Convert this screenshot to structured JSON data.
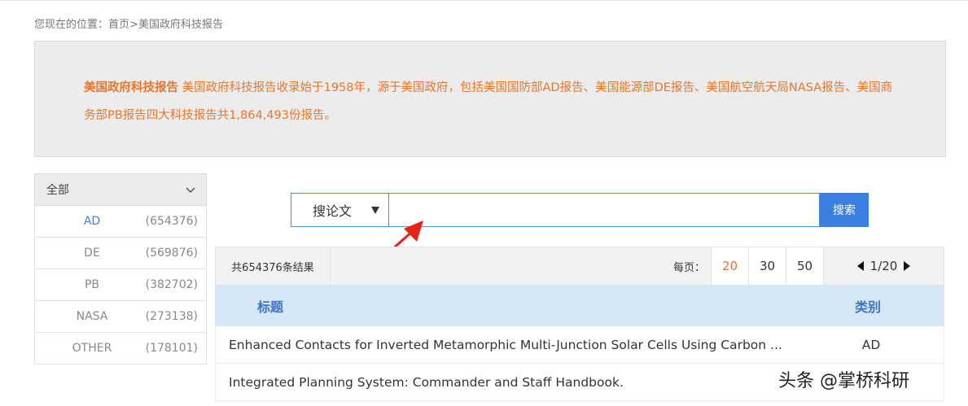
{
  "breadcrumb": {
    "prefix": "您现在的位置：",
    "home": "首页",
    "separator": ">",
    "current": "美国政府科技报告"
  },
  "intro": {
    "title": "美国政府科技报告",
    "text": " 美国政府科技报告收录始于1958年，源于美国政府，包括美国国防部AD报告、美国能源部DE报告、美国航空航天局NASA报告、美国商务部PB报告四大科技报告共1,864,493份报告。"
  },
  "sidebar": {
    "header": "全部",
    "items": [
      {
        "label": "AD",
        "count": "(654376)"
      },
      {
        "label": "DE",
        "count": "(569876)"
      },
      {
        "label": "PB",
        "count": "(382702)"
      },
      {
        "label": "NASA",
        "count": "(273138)"
      },
      {
        "label": "OTHER",
        "count": "(178101)"
      }
    ]
  },
  "search": {
    "type_label": "搜论文",
    "placeholder": "",
    "button": "搜索"
  },
  "results": {
    "total": "共654376条结果",
    "per_page_label": "每页：",
    "per_page_options": [
      "20",
      "30",
      "50"
    ],
    "pager": "1/20"
  },
  "table": {
    "col_title": "标题",
    "col_category": "类别",
    "rows": [
      {
        "title": "Enhanced Contacts for Inverted Metamorphic Multi-Junction Solar Cells Using Carbon ...",
        "category": "AD"
      },
      {
        "title": "Integrated Planning System: Commander and Staff Handbook.",
        "category": ""
      }
    ]
  },
  "watermark": "头条 @掌桥科研",
  "colors": {
    "accent_orange": "#e8772e",
    "link_blue": "#4a7fd2",
    "search_button": "#3b7fe0",
    "table_header_bg": "#d6e8f8",
    "arrow_red": "#e8231b"
  }
}
